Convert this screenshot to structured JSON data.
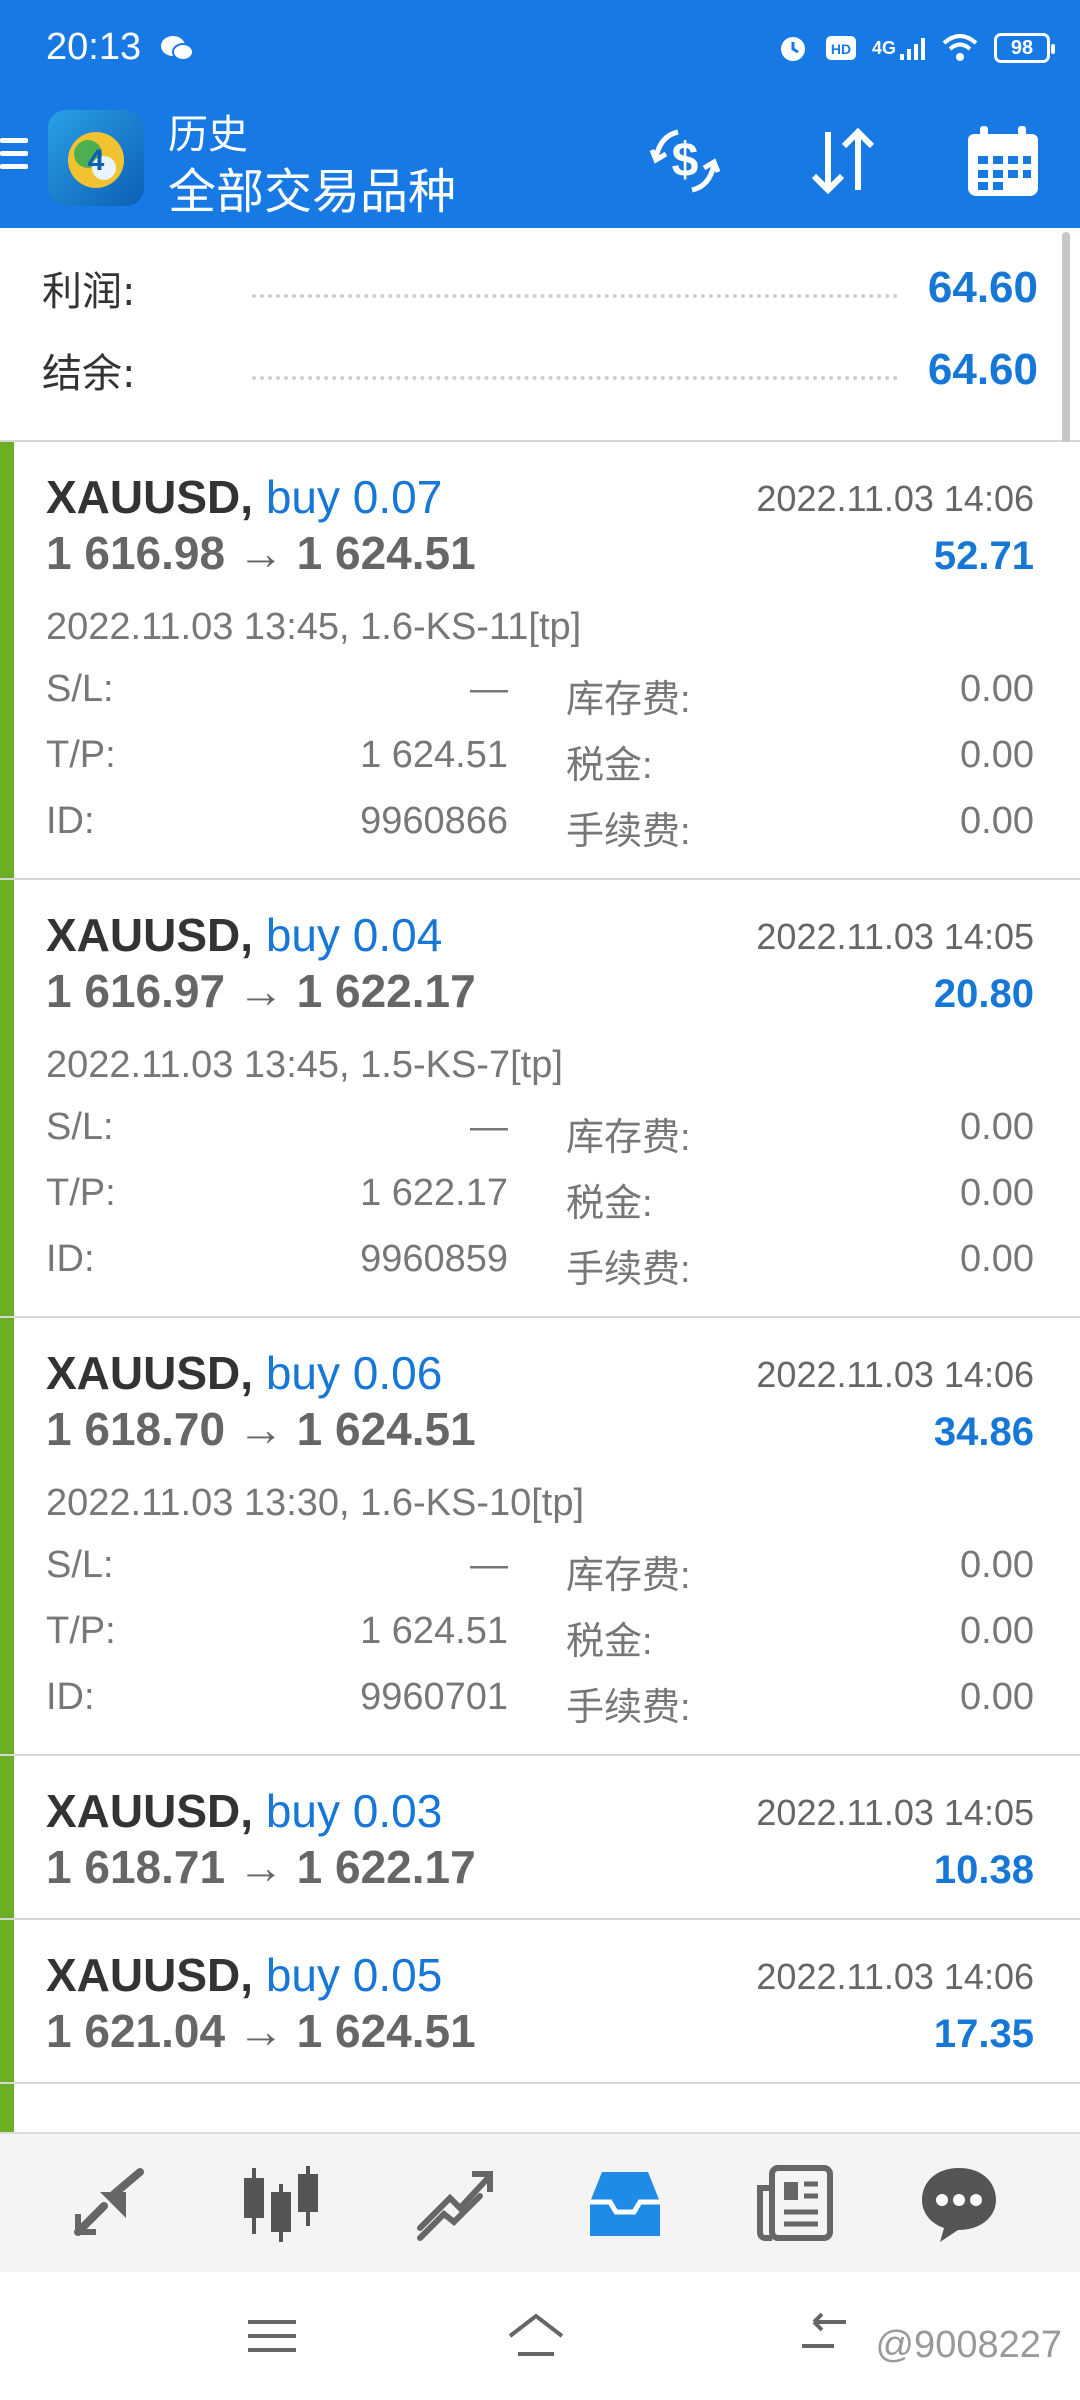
{
  "status_bar": {
    "time": "20:13",
    "network": "4G",
    "battery": "98"
  },
  "app_bar": {
    "title": "历史",
    "subtitle": "全部交易品种",
    "icons": [
      "menu-icon",
      "mt4-logo-icon",
      "currency-exchange-icon",
      "sort-icon",
      "calendar-icon"
    ]
  },
  "summary": {
    "profit_label": "利润:",
    "profit_value": "64.60",
    "balance_label": "结余:",
    "balance_value": "64.60"
  },
  "labels": {
    "sl": "S/L:",
    "tp": "T/P:",
    "id": "ID:",
    "swap": "库存费:",
    "tax": "税金:",
    "commission": "手续费:",
    "arrow": "→"
  },
  "trades": [
    {
      "symbol": "XAUUSD,",
      "side": "buy 0.07",
      "close_time": "2022.11.03 14:06",
      "open_price": "1 616.98",
      "close_price": "1 624.51",
      "profit": "52.71",
      "open_info": "2022.11.03 13:45, 1.6-KS-11[tp]",
      "sl": "—",
      "tp": "1 624.51",
      "id": "9960866",
      "swap": "0.00",
      "tax": "0.00",
      "commission": "0.00"
    },
    {
      "symbol": "XAUUSD,",
      "side": "buy 0.04",
      "close_time": "2022.11.03 14:05",
      "open_price": "1 616.97",
      "close_price": "1 622.17",
      "profit": "20.80",
      "open_info": "2022.11.03 13:45, 1.5-KS-7[tp]",
      "sl": "—",
      "tp": "1 622.17",
      "id": "9960859",
      "swap": "0.00",
      "tax": "0.00",
      "commission": "0.00"
    },
    {
      "symbol": "XAUUSD,",
      "side": "buy 0.06",
      "close_time": "2022.11.03 14:06",
      "open_price": "1 618.70",
      "close_price": "1 624.51",
      "profit": "34.86",
      "open_info": "2022.11.03 13:30, 1.6-KS-10[tp]",
      "sl": "—",
      "tp": "1 624.51",
      "id": "9960701",
      "swap": "0.00",
      "tax": "0.00",
      "commission": "0.00"
    },
    {
      "symbol": "XAUUSD,",
      "side": "buy 0.03",
      "close_time": "2022.11.03 14:05",
      "open_price": "1 618.71",
      "close_price": "1 622.17",
      "profit": "10.38"
    },
    {
      "symbol": "XAUUSD,",
      "side": "buy 0.05",
      "close_time": "2022.11.03 14:06",
      "open_price": "1 621.04",
      "close_price": "1 624.51",
      "profit": "17.35"
    }
  ],
  "bottom_nav": [
    "quotes-icon",
    "chart-icon",
    "trade-icon",
    "history-icon",
    "news-icon",
    "chat-icon"
  ],
  "watermark": "@9008227",
  "colors": {
    "primary": "#1779e4",
    "value_blue": "#1677d6",
    "buy_bar": "#6ab022"
  }
}
